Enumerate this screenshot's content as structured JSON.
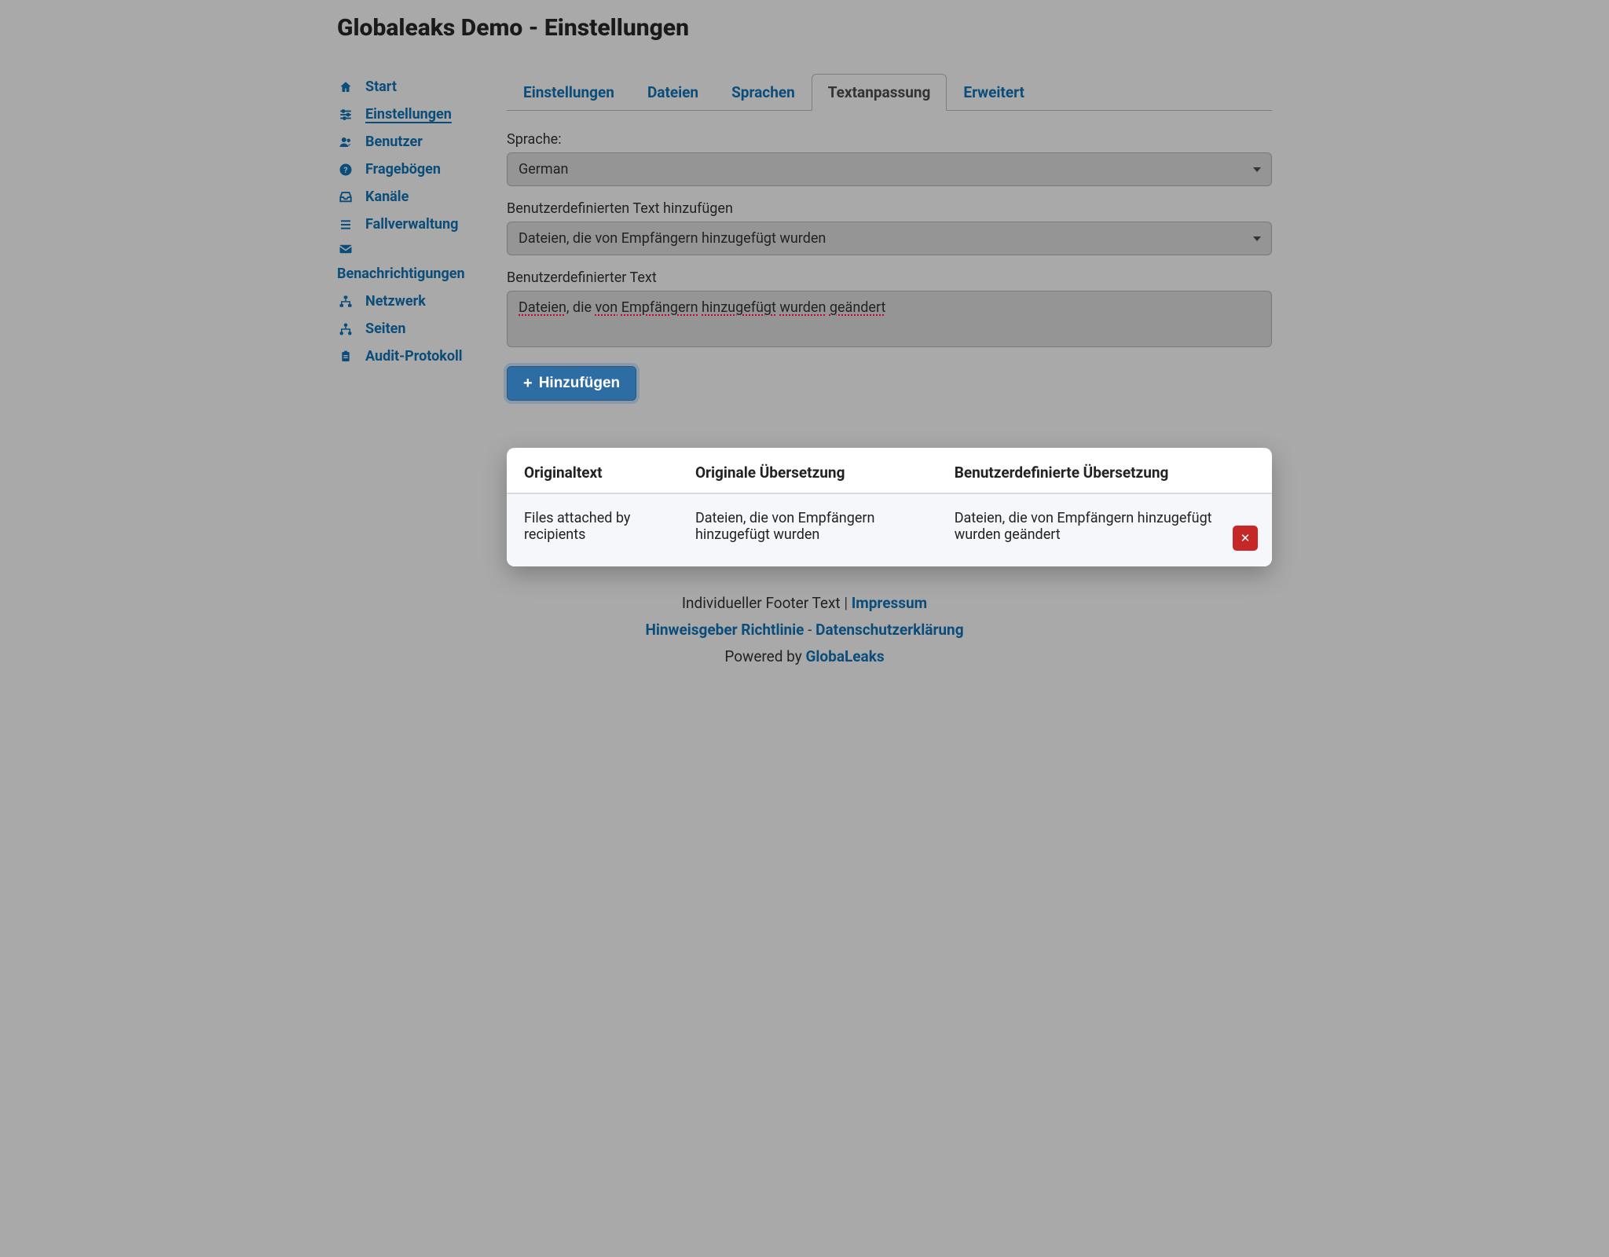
{
  "header": {
    "title": "Globaleaks Demo - Einstellungen"
  },
  "sidebar": {
    "items": [
      {
        "label": "Start",
        "icon": "home-icon"
      },
      {
        "label": "Einstellungen",
        "icon": "sliders-icon",
        "active": true
      },
      {
        "label": "Benutzer",
        "icon": "users-icon"
      },
      {
        "label": "Fragebögen",
        "icon": "question-circle-icon"
      },
      {
        "label": "Kanäle",
        "icon": "inbox-icon"
      },
      {
        "label": "Fallverwaltung",
        "icon": "list-icon"
      },
      {
        "label": "Benachrichtigungen",
        "icon": "envelope-icon"
      },
      {
        "label": "Netzwerk",
        "icon": "network-icon"
      },
      {
        "label": "Seiten",
        "icon": "sitemap-icon"
      },
      {
        "label": "Audit-Protokoll",
        "icon": "clipboard-icon"
      }
    ]
  },
  "tabs": {
    "items": [
      {
        "label": "Einstellungen"
      },
      {
        "label": "Dateien"
      },
      {
        "label": "Sprachen"
      },
      {
        "label": "Textanpassung",
        "active": true
      },
      {
        "label": "Erweitert"
      }
    ]
  },
  "form": {
    "language_label": "Sprache:",
    "language_value": "German",
    "add_custom_label": "Benutzerdefinierten Text hinzufügen",
    "add_custom_value": "Dateien, die von Empfängern hinzugefügt wurden",
    "custom_text_label": "Benutzerdefinierter Text",
    "custom_text_value": "Dateien, die von Empfängern hinzugefügt wurden geändert",
    "add_button": "Hinzufügen"
  },
  "table": {
    "headers": {
      "original": "Originaltext",
      "original_translation": "Originale Übersetzung",
      "custom_translation": "Benutzerdefinierte Übersetzung"
    },
    "rows": [
      {
        "original": "Files attached by recipients",
        "original_translation": "Dateien, die von Empfängern hinzugefügt wurden",
        "custom_translation": "Dateien, die von Empfängern hinzugefügt wurden geändert"
      }
    ]
  },
  "footer": {
    "custom_text": "Individueller Footer Text",
    "impressum": "Impressum",
    "hinweisgeber": "Hinweisgeber Richtlinie",
    "datenschutz": "Datenschutzerklärung",
    "powered_by_prefix": "Powered by ",
    "powered_by_link": "GlobaLeaks"
  },
  "colors": {
    "primary": "#0b4d7a",
    "button": "#2e6da4",
    "danger": "#c62828"
  }
}
